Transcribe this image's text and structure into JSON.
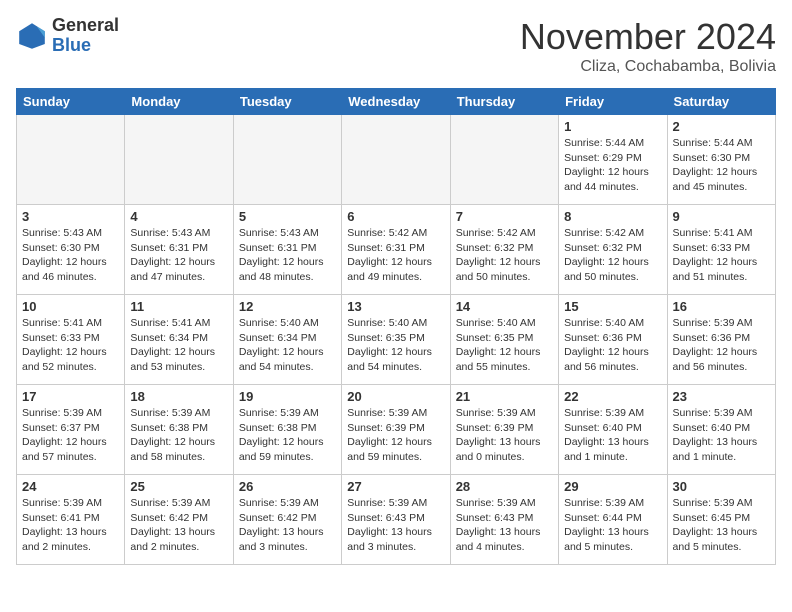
{
  "header": {
    "logo_general": "General",
    "logo_blue": "Blue",
    "month_title": "November 2024",
    "subtitle": "Cliza, Cochabamba, Bolivia"
  },
  "weekdays": [
    "Sunday",
    "Monday",
    "Tuesday",
    "Wednesday",
    "Thursday",
    "Friday",
    "Saturday"
  ],
  "weeks": [
    [
      {
        "day": "",
        "info": ""
      },
      {
        "day": "",
        "info": ""
      },
      {
        "day": "",
        "info": ""
      },
      {
        "day": "",
        "info": ""
      },
      {
        "day": "",
        "info": ""
      },
      {
        "day": "1",
        "info": "Sunrise: 5:44 AM\nSunset: 6:29 PM\nDaylight: 12 hours\nand 44 minutes."
      },
      {
        "day": "2",
        "info": "Sunrise: 5:44 AM\nSunset: 6:30 PM\nDaylight: 12 hours\nand 45 minutes."
      }
    ],
    [
      {
        "day": "3",
        "info": "Sunrise: 5:43 AM\nSunset: 6:30 PM\nDaylight: 12 hours\nand 46 minutes."
      },
      {
        "day": "4",
        "info": "Sunrise: 5:43 AM\nSunset: 6:31 PM\nDaylight: 12 hours\nand 47 minutes."
      },
      {
        "day": "5",
        "info": "Sunrise: 5:43 AM\nSunset: 6:31 PM\nDaylight: 12 hours\nand 48 minutes."
      },
      {
        "day": "6",
        "info": "Sunrise: 5:42 AM\nSunset: 6:31 PM\nDaylight: 12 hours\nand 49 minutes."
      },
      {
        "day": "7",
        "info": "Sunrise: 5:42 AM\nSunset: 6:32 PM\nDaylight: 12 hours\nand 50 minutes."
      },
      {
        "day": "8",
        "info": "Sunrise: 5:42 AM\nSunset: 6:32 PM\nDaylight: 12 hours\nand 50 minutes."
      },
      {
        "day": "9",
        "info": "Sunrise: 5:41 AM\nSunset: 6:33 PM\nDaylight: 12 hours\nand 51 minutes."
      }
    ],
    [
      {
        "day": "10",
        "info": "Sunrise: 5:41 AM\nSunset: 6:33 PM\nDaylight: 12 hours\nand 52 minutes."
      },
      {
        "day": "11",
        "info": "Sunrise: 5:41 AM\nSunset: 6:34 PM\nDaylight: 12 hours\nand 53 minutes."
      },
      {
        "day": "12",
        "info": "Sunrise: 5:40 AM\nSunset: 6:34 PM\nDaylight: 12 hours\nand 54 minutes."
      },
      {
        "day": "13",
        "info": "Sunrise: 5:40 AM\nSunset: 6:35 PM\nDaylight: 12 hours\nand 54 minutes."
      },
      {
        "day": "14",
        "info": "Sunrise: 5:40 AM\nSunset: 6:35 PM\nDaylight: 12 hours\nand 55 minutes."
      },
      {
        "day": "15",
        "info": "Sunrise: 5:40 AM\nSunset: 6:36 PM\nDaylight: 12 hours\nand 56 minutes."
      },
      {
        "day": "16",
        "info": "Sunrise: 5:39 AM\nSunset: 6:36 PM\nDaylight: 12 hours\nand 56 minutes."
      }
    ],
    [
      {
        "day": "17",
        "info": "Sunrise: 5:39 AM\nSunset: 6:37 PM\nDaylight: 12 hours\nand 57 minutes."
      },
      {
        "day": "18",
        "info": "Sunrise: 5:39 AM\nSunset: 6:38 PM\nDaylight: 12 hours\nand 58 minutes."
      },
      {
        "day": "19",
        "info": "Sunrise: 5:39 AM\nSunset: 6:38 PM\nDaylight: 12 hours\nand 59 minutes."
      },
      {
        "day": "20",
        "info": "Sunrise: 5:39 AM\nSunset: 6:39 PM\nDaylight: 12 hours\nand 59 minutes."
      },
      {
        "day": "21",
        "info": "Sunrise: 5:39 AM\nSunset: 6:39 PM\nDaylight: 13 hours\nand 0 minutes."
      },
      {
        "day": "22",
        "info": "Sunrise: 5:39 AM\nSunset: 6:40 PM\nDaylight: 13 hours\nand 1 minute."
      },
      {
        "day": "23",
        "info": "Sunrise: 5:39 AM\nSunset: 6:40 PM\nDaylight: 13 hours\nand 1 minute."
      }
    ],
    [
      {
        "day": "24",
        "info": "Sunrise: 5:39 AM\nSunset: 6:41 PM\nDaylight: 13 hours\nand 2 minutes."
      },
      {
        "day": "25",
        "info": "Sunrise: 5:39 AM\nSunset: 6:42 PM\nDaylight: 13 hours\nand 2 minutes."
      },
      {
        "day": "26",
        "info": "Sunrise: 5:39 AM\nSunset: 6:42 PM\nDaylight: 13 hours\nand 3 minutes."
      },
      {
        "day": "27",
        "info": "Sunrise: 5:39 AM\nSunset: 6:43 PM\nDaylight: 13 hours\nand 3 minutes."
      },
      {
        "day": "28",
        "info": "Sunrise: 5:39 AM\nSunset: 6:43 PM\nDaylight: 13 hours\nand 4 minutes."
      },
      {
        "day": "29",
        "info": "Sunrise: 5:39 AM\nSunset: 6:44 PM\nDaylight: 13 hours\nand 5 minutes."
      },
      {
        "day": "30",
        "info": "Sunrise: 5:39 AM\nSunset: 6:45 PM\nDaylight: 13 hours\nand 5 minutes."
      }
    ]
  ]
}
